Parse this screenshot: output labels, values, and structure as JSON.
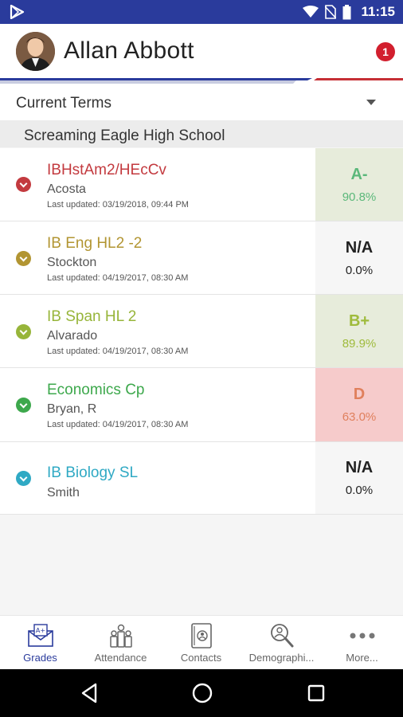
{
  "status_bar": {
    "time": "11:15"
  },
  "header": {
    "student_name": "Allan Abbott",
    "notification_count": "1"
  },
  "term_selector": {
    "label": "Current Terms"
  },
  "school": {
    "name": "Screaming Eagle High School"
  },
  "courses": [
    {
      "name": "IBHstAm2/HEcCv",
      "teacher": "Acosta",
      "last_updated": "Last updated: 03/19/2018, 09:44 PM",
      "letter": "A-",
      "percent": "90.8%",
      "color": "#c33a3f",
      "grade_color": "#5bb87a",
      "grade_bg": "#e7ecdb"
    },
    {
      "name": "IB Eng HL2 -2",
      "teacher": "Stockton",
      "last_updated": "Last updated: 04/19/2017, 08:30 AM",
      "letter": "N/A",
      "percent": "0.0%",
      "color": "#b29532",
      "grade_color": "#222222",
      "grade_bg": "#f6f6f6"
    },
    {
      "name": "IB Span HL 2",
      "teacher": "Alvarado",
      "last_updated": "Last updated: 04/19/2017, 08:30 AM",
      "letter": "B+",
      "percent": "89.9%",
      "color": "#97b53a",
      "grade_color": "#9fbb3c",
      "grade_bg": "#e7ecdb"
    },
    {
      "name": "Economics Cp",
      "teacher": "Bryan, R",
      "last_updated": "Last updated: 04/19/2017, 08:30 AM",
      "letter": "D",
      "percent": "63.0%",
      "color": "#3da84c",
      "grade_color": "#e0805d",
      "grade_bg": "#f6cbcb"
    },
    {
      "name": "IB Biology SL",
      "teacher": "Smith",
      "last_updated": "",
      "letter": "N/A",
      "percent": "0.0%",
      "color": "#2fa9c4",
      "grade_color": "#222222",
      "grade_bg": "#f6f6f6"
    }
  ],
  "tabs": [
    {
      "label": "Grades",
      "icon": "envelope-a-plus-icon",
      "active": true
    },
    {
      "label": "Attendance",
      "icon": "people-icon",
      "active": false
    },
    {
      "label": "Contacts",
      "icon": "contact-book-icon",
      "active": false
    },
    {
      "label": "Demographi...",
      "icon": "magnifier-person-icon",
      "active": false
    },
    {
      "label": "More...",
      "icon": "more-dots-icon",
      "active": false
    }
  ],
  "colors": {
    "status_bar": "#2a3b9c",
    "stripe_blue": "#2a3b9c",
    "stripe_red": "#c62f35",
    "active_tab": "#2a3b9c"
  }
}
